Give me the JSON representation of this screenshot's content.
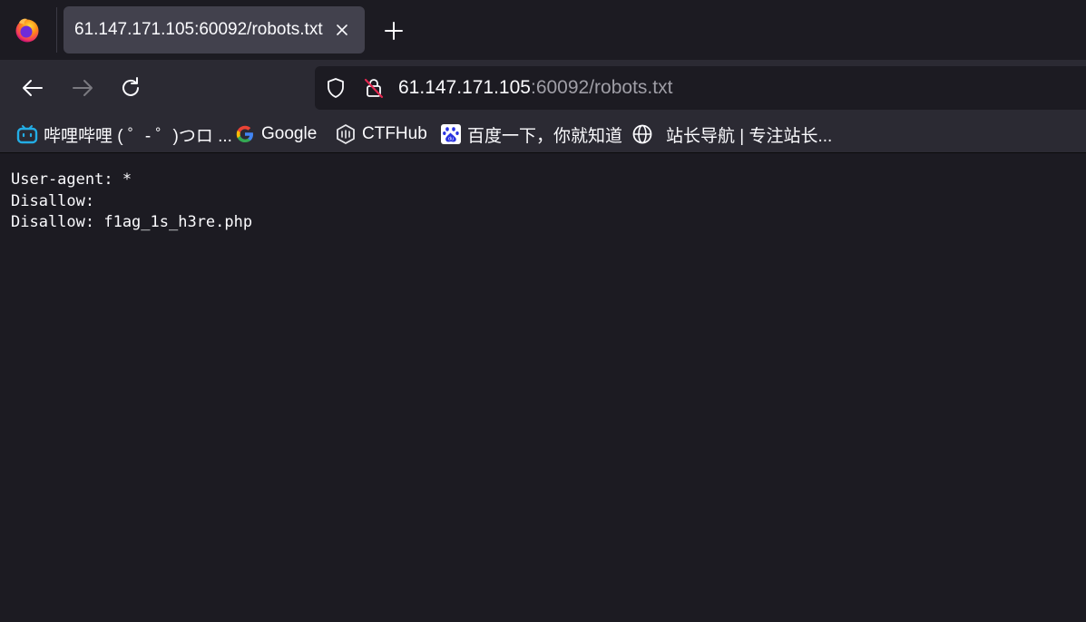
{
  "tab": {
    "title": "61.147.171.105:60092/robots.txt",
    "close_icon": "close-icon",
    "new_tab_icon": "plus-icon"
  },
  "nav": {
    "back_icon": "arrow-left-icon",
    "forward_icon": "arrow-right-icon",
    "reload_icon": "reload-icon"
  },
  "urlbar": {
    "host": "61.147.171.105",
    "rest": ":60092/robots.txt",
    "shield_icon": "shield-icon",
    "insecure_icon": "insecure-lock-icon"
  },
  "bookmarks": [
    {
      "label": "哔哩哔哩 ( ゜- ゜)つロ ...",
      "icon": "bilibili-icon"
    },
    {
      "label": "Google",
      "icon": "google-icon"
    },
    {
      "label": "CTFHub",
      "icon": "ctfhub-icon"
    },
    {
      "label": "百度一下，你就知道",
      "icon": "baidu-icon"
    },
    {
      "label": "站长导航 | 专注站长...",
      "icon": "globe-icon"
    }
  ],
  "content": {
    "lines": [
      "User-agent: *",
      "Disallow:",
      "Disallow: f1ag_1s_h3re.php"
    ]
  },
  "colors": {
    "background": "#1c1b22",
    "toolbar": "#2b2a33",
    "active_tab": "#42414d",
    "text": "#fbfbfe",
    "muted_text": "#9f9ea6"
  }
}
